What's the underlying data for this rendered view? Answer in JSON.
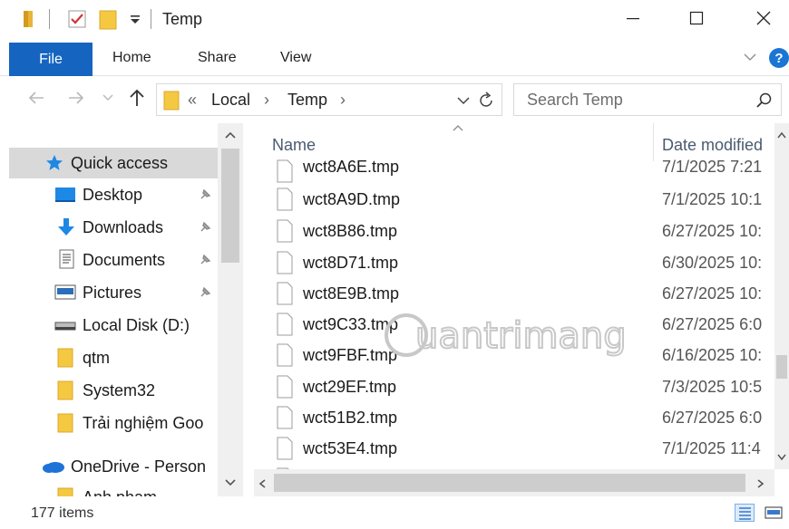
{
  "window": {
    "title": "Temp",
    "minimize_glyph": "—",
    "maximize_glyph": "☐",
    "close_glyph": "✕"
  },
  "ribbon": {
    "tabs": [
      "File",
      "Home",
      "Share",
      "View"
    ],
    "help_glyph": "?"
  },
  "address": {
    "prefix": "«",
    "segments": [
      "Local",
      "Temp"
    ],
    "separator": "›"
  },
  "search": {
    "placeholder": "Search Temp"
  },
  "nav": {
    "items": [
      {
        "label": "Quick access",
        "icon": "star-icon",
        "pinned": false
      },
      {
        "label": "Desktop",
        "icon": "desktop-icon",
        "pinned": true
      },
      {
        "label": "Downloads",
        "icon": "download-icon",
        "pinned": true
      },
      {
        "label": "Documents",
        "icon": "documents-icon",
        "pinned": true
      },
      {
        "label": "Pictures",
        "icon": "pictures-icon",
        "pinned": true
      },
      {
        "label": "Local Disk (D:)",
        "icon": "drive-icon",
        "pinned": false
      },
      {
        "label": "qtm",
        "icon": "folder-icon",
        "pinned": false
      },
      {
        "label": "System32",
        "icon": "folder-icon",
        "pinned": false
      },
      {
        "label": "Trải nghiệm Goo",
        "icon": "folder-icon",
        "pinned": false
      },
      {
        "label": "OneDrive - Person",
        "icon": "onedrive-icon",
        "pinned": false
      },
      {
        "label": "Anh pham",
        "icon": "folder-icon",
        "pinned": false
      }
    ]
  },
  "files": {
    "columns": [
      "Name",
      "Date modified"
    ],
    "rows": [
      {
        "name": "wct8A6E.tmp",
        "date": "7/1/2025 7:21"
      },
      {
        "name": "wct8A9D.tmp",
        "date": "7/1/2025 10:1"
      },
      {
        "name": "wct8B86.tmp",
        "date": "6/27/2025 10:"
      },
      {
        "name": "wct8D71.tmp",
        "date": "6/30/2025 10:"
      },
      {
        "name": "wct8E9B.tmp",
        "date": "6/27/2025 10:"
      },
      {
        "name": "wct9C33.tmp",
        "date": "6/27/2025 6:0"
      },
      {
        "name": "wct9FBF.tmp",
        "date": "6/16/2025 10:"
      },
      {
        "name": "wct29EF.tmp",
        "date": "7/3/2025 10:5"
      },
      {
        "name": "wct51B2.tmp",
        "date": "6/27/2025 6:0"
      },
      {
        "name": "wct53E4.tmp",
        "date": "7/1/2025 11:4"
      }
    ]
  },
  "status": {
    "item_count": "177 items"
  },
  "watermark": {
    "text": "uantrimang"
  },
  "colors": {
    "accent": "#1565c0",
    "folder": "#f5c842",
    "selection": "#d9d9d9"
  }
}
